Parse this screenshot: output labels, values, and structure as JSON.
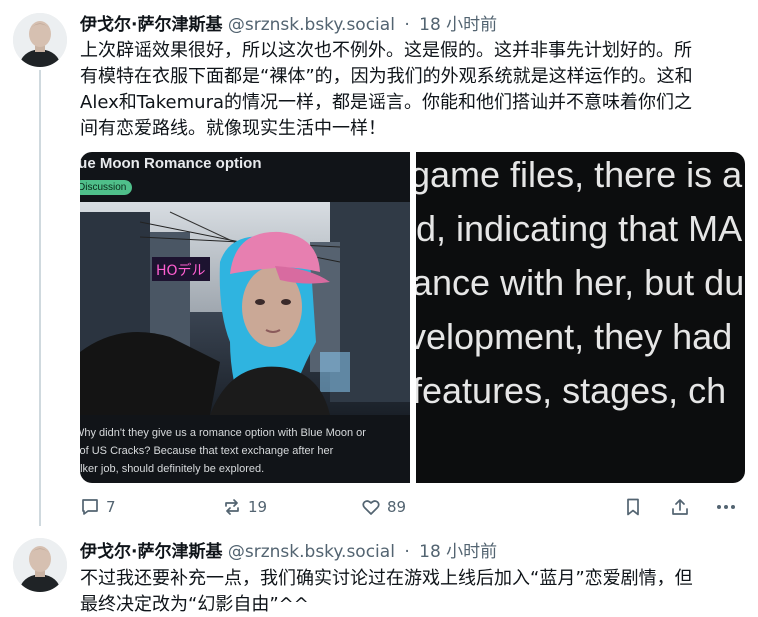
{
  "thread": {
    "posts": [
      {
        "author": {
          "name": "伊戈尔·萨尔津斯基",
          "handle": "@srznsk.bsky.social",
          "separator": "·",
          "time": "18 小时前"
        },
        "text": "上次辟谣效果很好，所以这次也不例外。这是假的。这并非事先计划好的。所\n有模特在衣服下面都是“裸体”的，因为我们的外观系统就是这样运作的。这和\nAlex和Takemura的情况一样，都是谣言。你能和他们搭讪并不意味着你们之\n间有恋爱路线。就像现实生活中一样！",
        "media": {
          "left": {
            "title": "lue Moon Romance option",
            "flair": "Discussion",
            "sign": "HOデル",
            "caption": "Why didn't they give us a romance option with Blue Moon or\nl of US Cracks? Because that text exchange after her\nalker job, should definitely be explored."
          },
          "right": {
            "lines": [
              "game files, there is a",
              "d, indicating that MA",
              "ance with her, but du",
              "velopment, they had",
              " features, stages, ch"
            ]
          }
        },
        "actions": {
          "reply_count": "7",
          "repost_count": "19",
          "like_count": "89"
        }
      },
      {
        "author": {
          "name": "伊戈尔·萨尔津斯基",
          "handle": "@srznsk.bsky.social",
          "separator": "·",
          "time": "18 小时前"
        },
        "text": "不过我还要补充一点，我们确实讨论过在游戏上线后加入“蓝月”恋爱剧情，但\n最终决定改为“幻影自由”^^"
      }
    ]
  },
  "icons": {
    "reply": "reply-icon",
    "repost": "repost-icon",
    "like": "heart-icon",
    "bookmark": "bookmark-icon",
    "share": "share-icon",
    "more": "more-icon"
  },
  "colors": {
    "text": "#0f1419",
    "muted": "#536471",
    "thread_line": "#cfd9de",
    "flair": "#4fbf8a",
    "hair": "#2fb4e0",
    "cap": "#e77fb0"
  }
}
